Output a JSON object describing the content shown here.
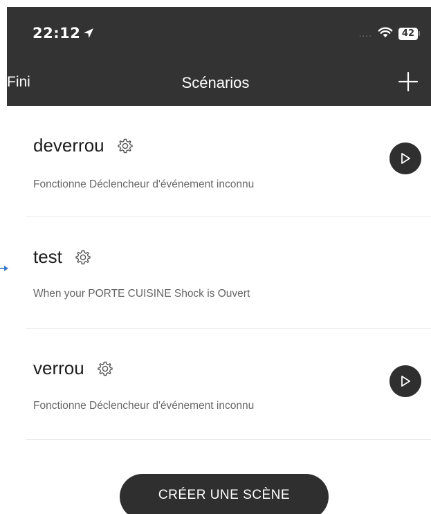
{
  "status_bar": {
    "time": "22:12",
    "signal": "....",
    "battery": "42"
  },
  "nav": {
    "done_label": "Fini",
    "title": "Scénarios",
    "add_icon": "plus-icon"
  },
  "scenes": [
    {
      "name": "deverrou",
      "description": "Fonctionne Déclencheur d'événement inconnu",
      "has_play": true
    },
    {
      "name": "test",
      "description": "When your PORTE CUISINE  Shock is Ouvert",
      "has_play": false
    },
    {
      "name": "verrou",
      "description": "Fonctionne Déclencheur d'événement inconnu",
      "has_play": true
    }
  ],
  "create_button": {
    "label": "CRÉER UNE SCÈNE"
  },
  "colors": {
    "header_bg": "#333333",
    "button_bg": "#2f2f2f",
    "divider": "#e8e8e8",
    "annotation_arrow": "#3a78c9"
  }
}
